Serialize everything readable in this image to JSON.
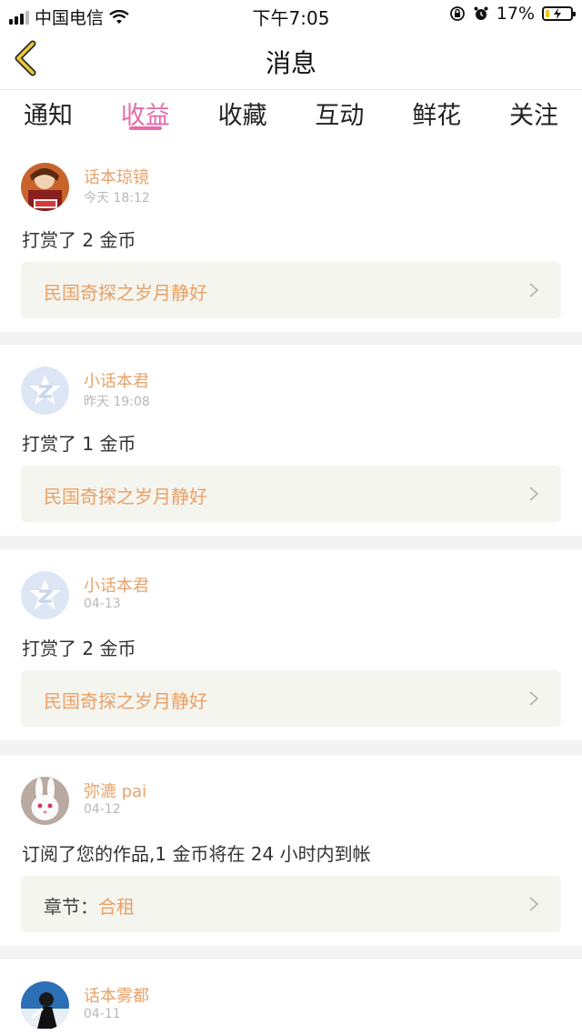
{
  "status_bar": {
    "carrier": "中国电信",
    "time": "下午7:05",
    "battery_percent": "17%",
    "battery_level": 0.17
  },
  "navbar": {
    "title": "消息"
  },
  "tabs": [
    {
      "label": "通知",
      "active": false
    },
    {
      "label": "收益",
      "active": true
    },
    {
      "label": "收藏",
      "active": false
    },
    {
      "label": "互动",
      "active": false
    },
    {
      "label": "鲜花",
      "active": false
    },
    {
      "label": "关注",
      "active": false
    }
  ],
  "messages": [
    {
      "user": "话本琼镜",
      "time": "今天 18:12",
      "action": "打赏了 2 金币",
      "link": "民国奇探之岁月静好",
      "avatar": "cartoon-avatar"
    },
    {
      "user": "小话本君",
      "time": "昨天 19:08",
      "action": "打赏了 1 金币",
      "link": "民国奇探之岁月静好",
      "avatar": "default-avatar"
    },
    {
      "user": "小话本君",
      "time": "04-13",
      "action": "打赏了 2 金币",
      "link": "民国奇探之岁月静好",
      "avatar": "default-avatar"
    },
    {
      "user": "弥漉 pai",
      "time": "04-12",
      "action": "订阅了您的作品,1 金币将在 24 小时内到帐",
      "link_prefix": "章节：",
      "link": "合租",
      "avatar": "bunny-avatar"
    },
    {
      "user": "话本雾都",
      "time": "04-11",
      "avatar": "photo-avatar"
    }
  ],
  "colors": {
    "accent_pink": "#e96aa9",
    "username_orange": "#e8a26a",
    "link_orange": "#e9a065",
    "back_yellow": "#e9c93a"
  }
}
